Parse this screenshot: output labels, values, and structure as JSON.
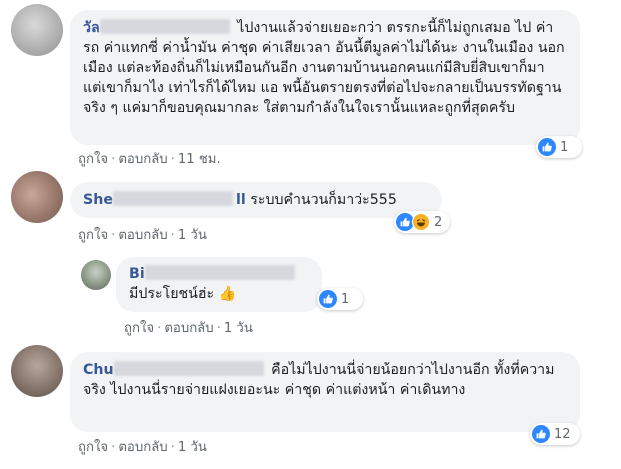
{
  "comments": [
    {
      "name_visible": "วัล",
      "text": "ไปงานแล้วจ่ายเยอะกว่า ตรรกะนี้ก็ไม่ถูกเสมอ ไป ค่ารถ ค่าแทกซี่ ค่าน้ำมัน ค่าชุด ค่าเสียเวลา อันนี้ตีมูลค่าไม่ได้นะ งานในเมือง นอกเมือง แต่ละท้องถิ่นก็ไม่เหมือนกันอีก งานตามบ้านนอกคนแก่มีสิบยี่สิบเขาก็มา แต่เขาก็มาไง เท่าไรก็ได้ไหม แอ พนี้อันตรายตรงที่ต่อไปจะกลายเป็นบรรทัดฐาน จริง ๆ แค่มาก็ขอบคุณมากละ ใส่ตามกำลังในใจเรานั้นแหละถูกที่สุดครับ",
      "like_label": "ถูกใจ",
      "reply_label": "ตอบกลับ",
      "time": "11 ชม.",
      "reaction_count": "1"
    },
    {
      "name_visible": "She",
      "name_tail": "ll",
      "text": "ระบบคำนวนก็มาว่ะ555",
      "like_label": "ถูกใจ",
      "reply_label": "ตอบกลับ",
      "time": "1 วัน",
      "reaction_count": "2"
    },
    {
      "name_visible": "Bi",
      "text": "มีประโยชน์ฮ่ะ 👍",
      "like_label": "ถูกใจ",
      "reply_label": "ตอบกลับ",
      "time": "1 วัน",
      "reaction_count": "1"
    },
    {
      "name_visible": "Chu",
      "text": "คือไม่ไปงานนี่จ่ายน้อยกว่าไปงานอีก ทั้งที่ความจริง ไปงานนี่รายจ่ายแฝงเยอะนะ ค่าชุด ค่าแต่งหน้า ค่าเดินทาง",
      "like_label": "ถูกใจ",
      "reply_label": "ตอบกลับ",
      "time": "1 วัน",
      "reaction_count": "12"
    }
  ],
  "colors": {
    "bubble": "#f2f3f5",
    "name": "#385898",
    "meta": "#606770",
    "like": "#2d88ff",
    "haha": "#f7b125"
  },
  "icons": [
    "like-icon",
    "haha-icon"
  ]
}
